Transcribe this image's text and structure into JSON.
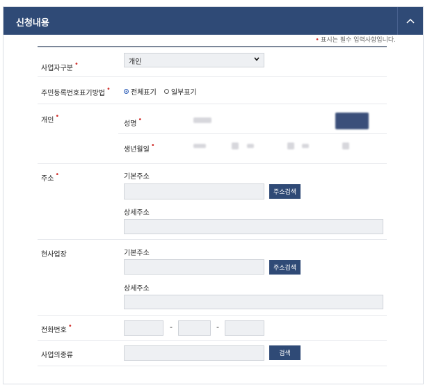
{
  "header": {
    "title": "신청내용"
  },
  "required_note": "표시는 필수 입력사항입니다.",
  "fields": {
    "business_type": {
      "label": "사업자구분",
      "value": "개인"
    },
    "rrn_display": {
      "label": "주민등록번호표기방법",
      "option_full": "전체표기",
      "option_partial": "일부표기"
    },
    "individual": {
      "label": "개인",
      "name_label": "성명",
      "birth_label": "생년월일"
    },
    "address": {
      "label": "주소",
      "basic_label": "기본주소",
      "search_btn": "주소검색",
      "detail_label": "상세주소"
    },
    "site": {
      "label": "현사업장",
      "basic_label": "기본주소",
      "search_btn": "주소검색",
      "detail_label": "상세주소"
    },
    "phone": {
      "label": "전화번호",
      "sep": "-"
    },
    "business_kind": {
      "label": "사업의종류",
      "search_btn": "검색"
    }
  },
  "colors": {
    "header_bg": "#2f4a76",
    "required": "#d1322e",
    "input_bg": "#eef0f3"
  }
}
